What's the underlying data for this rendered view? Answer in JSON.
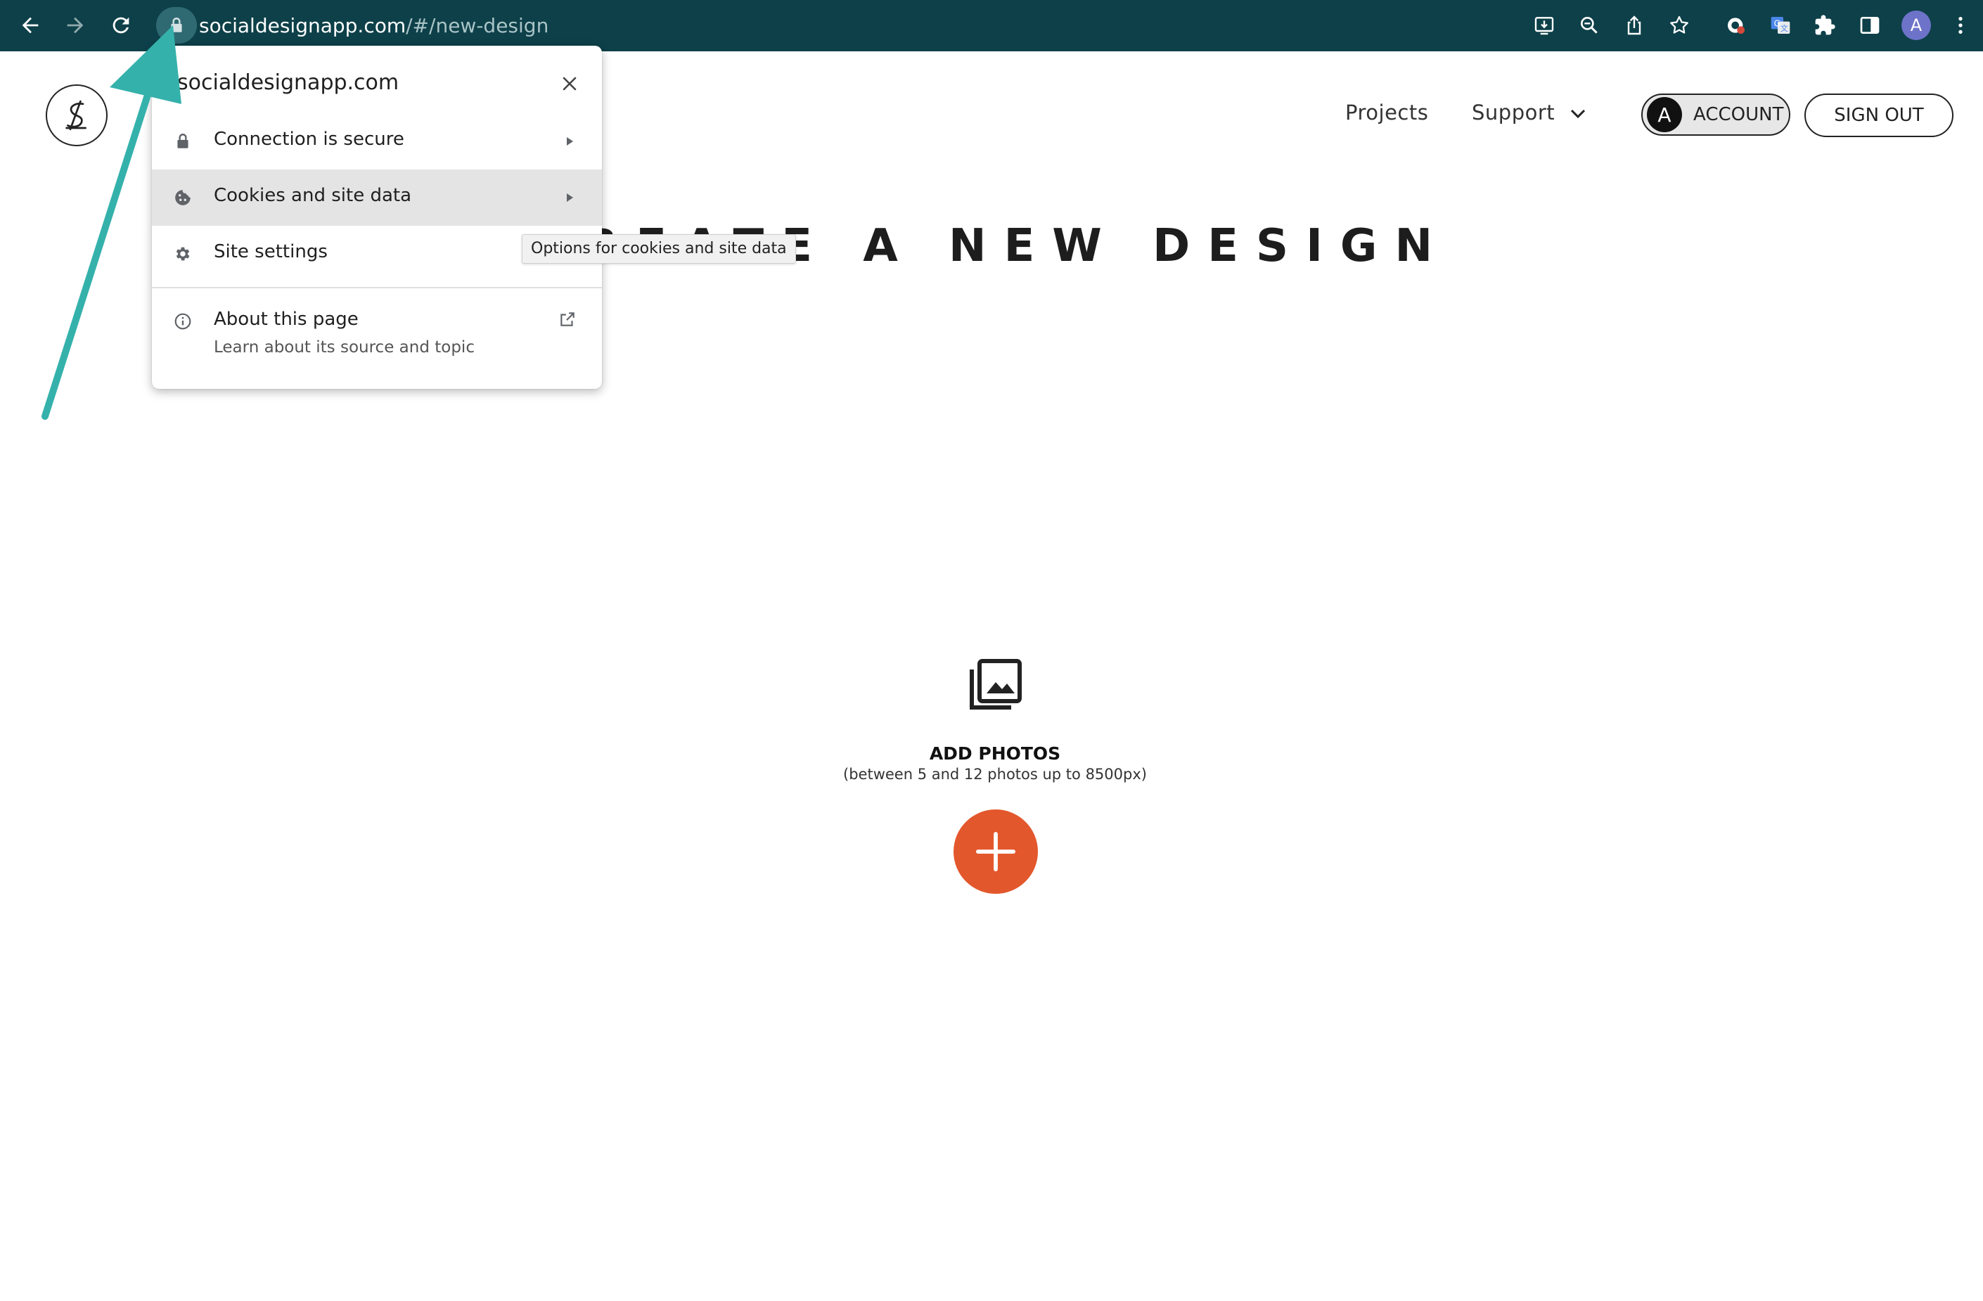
{
  "browser": {
    "url_host": "socialdesignapp.com",
    "url_path": "/#/new-design",
    "profile_initial": "A",
    "icons": [
      "back-arrow",
      "forward-arrow",
      "reload",
      "lock",
      "install",
      "zoom",
      "share",
      "bookmark-star",
      "extension-privacy",
      "google-translate",
      "puzzle-piece",
      "side-panel",
      "profile",
      "more-vertical"
    ]
  },
  "site_popup": {
    "domain": "socialdesignapp.com",
    "items": [
      {
        "label": "Connection is secure",
        "icon": "lock-icon"
      },
      {
        "label": "Cookies and site data",
        "icon": "cookie-icon"
      },
      {
        "label": "Site settings",
        "icon": "gear-icon"
      }
    ],
    "about": {
      "title": "About this page",
      "subtitle": "Learn about its source and topic"
    },
    "tooltip": "Options for cookies and site data"
  },
  "header": {
    "nav": {
      "projects": "Projects",
      "support": "Support"
    },
    "account_initial": "A",
    "account_label": "ACCOUNT",
    "signout_label": "SIGN OUT"
  },
  "main": {
    "title": "CREATE A NEW DESIGN",
    "add_photos_title": "ADD PHOTOS",
    "add_photos_hint": "(between 5 and 12 photos up to 8500px)"
  },
  "colors": {
    "chrome_bg": "#0d4049",
    "add_button": "#e3572c",
    "annotation_arrow": "#35b1ab"
  }
}
